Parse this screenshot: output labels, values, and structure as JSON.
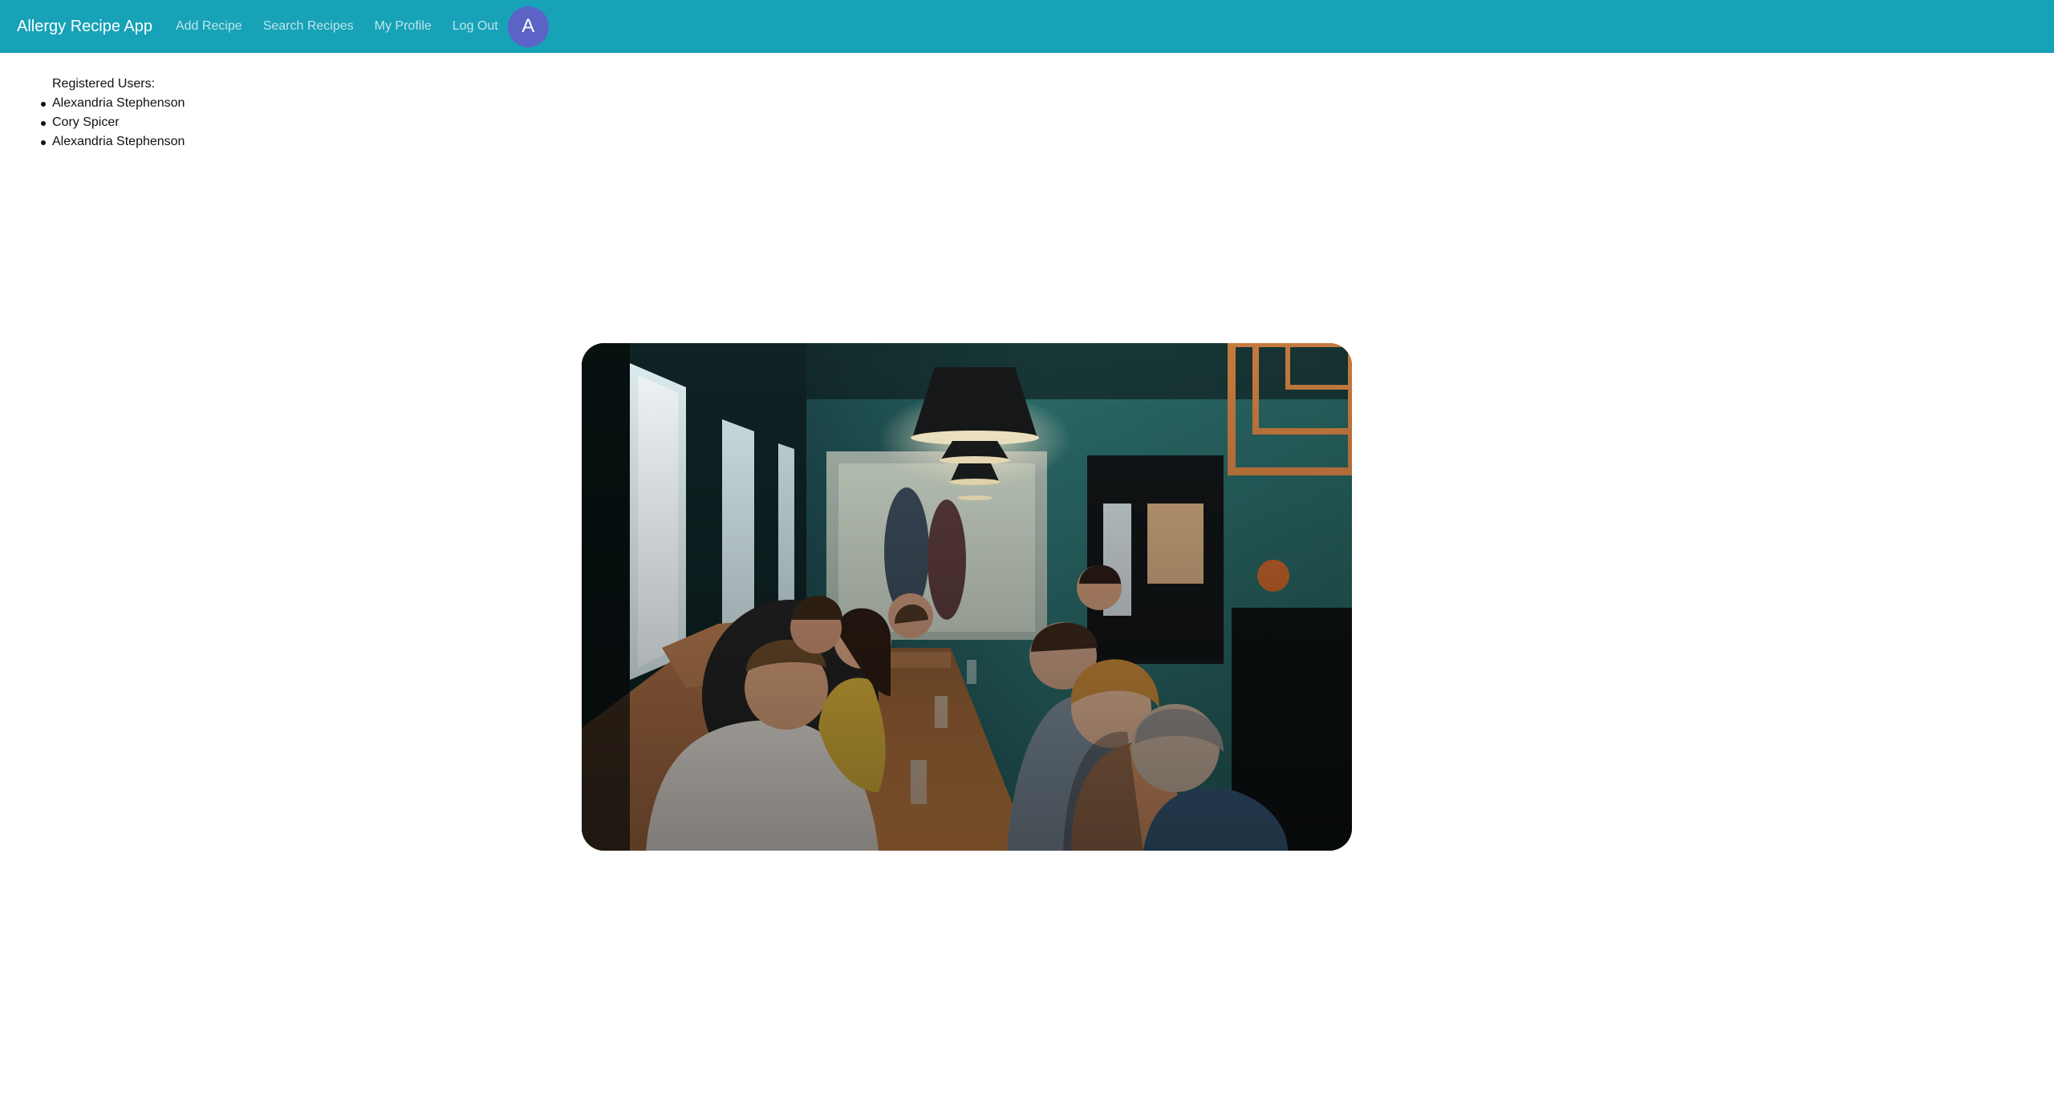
{
  "navbar": {
    "brand": "Allergy Recipe App",
    "links": [
      "Add Recipe",
      "Search Recipes",
      "My Profile",
      "Log Out"
    ],
    "avatar_letter": "A",
    "background_color": "#17a2b8",
    "avatar_color": "#5b63c7"
  },
  "users": {
    "heading": "Registered Users:",
    "names": [
      "Alexandria Stephenson",
      "Cory Spicer",
      "Alexandria Stephenson"
    ]
  },
  "image": {
    "description": "restaurant-photo"
  }
}
